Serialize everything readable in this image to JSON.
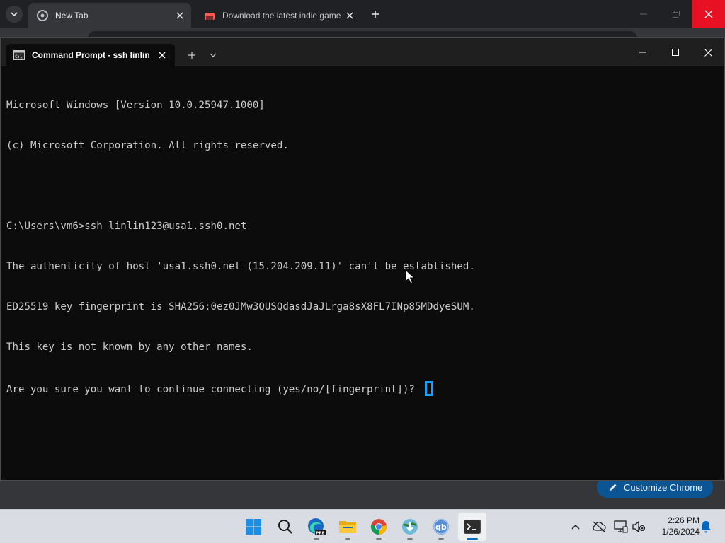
{
  "chrome": {
    "tabs": [
      {
        "title": "New Tab"
      },
      {
        "title": "Download the latest indie game"
      }
    ],
    "customize_label": "Customize Chrome"
  },
  "terminal": {
    "tab_title": "Command Prompt - ssh  linlin",
    "lines": [
      "Microsoft Windows [Version 10.0.25947.1000]",
      "(c) Microsoft Corporation. All rights reserved.",
      "",
      "C:\\Users\\vm6>ssh linlin123@usa1.ssh0.net",
      "The authenticity of host 'usa1.ssh0.net (15.204.209.11)' can't be established.",
      "ED25519 key fingerprint is SHA256:0ez0JMw3QUSQdasdJaJLrga8sX8FL7INp85MDdyeSUM.",
      "This key is not known by any other names.",
      "Are you sure you want to continue connecting (yes/no/[fingerprint])? "
    ]
  },
  "taskbar": {
    "apps": [
      "start",
      "search",
      "edge-beta",
      "file-explorer",
      "chrome",
      "installer",
      "qbittorrent",
      "terminal"
    ],
    "badge_pre": "PRE",
    "time": "2:26 PM",
    "date": "1/26/2024"
  }
}
